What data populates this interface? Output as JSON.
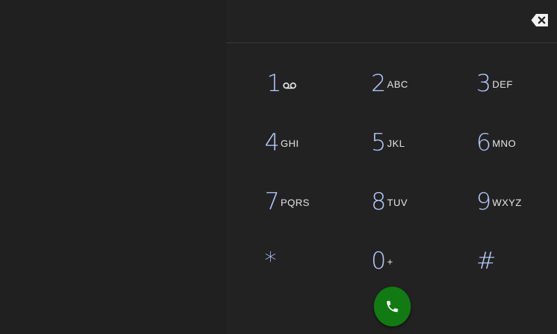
{
  "dialer": {
    "backspace_icon": "backspace-icon",
    "call_icon": "phone-icon",
    "voicemail_icon": "voicemail-icon",
    "colors": {
      "background": "#222222",
      "digit": "#b6c9ff",
      "letters": "#e6e6e6",
      "call_button": "#127a12"
    },
    "keys": [
      {
        "digit": "1",
        "letters": ""
      },
      {
        "digit": "2",
        "letters": "ABC"
      },
      {
        "digit": "3",
        "letters": "DEF"
      },
      {
        "digit": "4",
        "letters": "GHI"
      },
      {
        "digit": "5",
        "letters": "JKL"
      },
      {
        "digit": "6",
        "letters": "MNO"
      },
      {
        "digit": "7",
        "letters": "PQRS"
      },
      {
        "digit": "8",
        "letters": "TUV"
      },
      {
        "digit": "9",
        "letters": "WXYZ"
      },
      {
        "digit": "*",
        "letters": ""
      },
      {
        "digit": "0",
        "letters": "+"
      },
      {
        "digit": "#",
        "letters": ""
      }
    ]
  }
}
